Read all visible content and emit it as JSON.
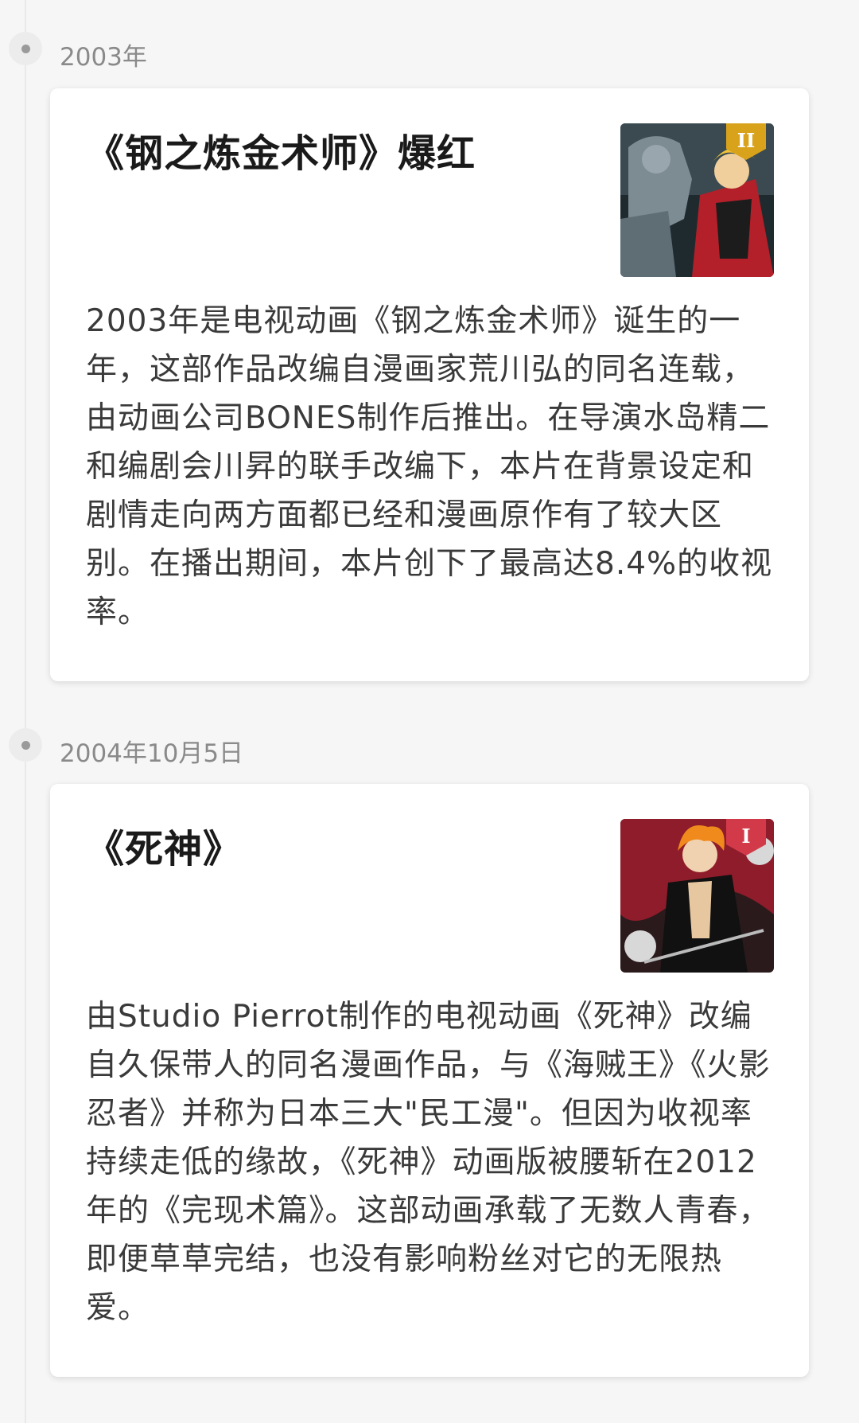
{
  "entries": [
    {
      "date": "2003年",
      "title": "《钢之炼金术师》爆红",
      "image_icon": "fullmetal-alchemist-thumbnail",
      "badge": "II",
      "body": "2003年是电视动画《钢之炼金术师》诞生的一年，这部作品改编自漫画家荒川弘的同名连载，由动画公司BONES制作后推出。在导演水岛精二和编剧会川昇的联手改编下，本片在背景设定和剧情走向两方面都已经和漫画原作有了较大区别。在播出期间，本片创下了最高达8.4%的收视率。"
    },
    {
      "date": "2004年10月5日",
      "title": "《死神》",
      "image_icon": "bleach-thumbnail",
      "badge": "I",
      "body": "由Studio Pierrot制作的电视动画《死神》改编自久保带人的同名漫画作品，与《海贼王》《火影忍者》并称为日本三大\"民工漫\"。但因为收视率持续走低的缘故，《死神》动画版被腰斩在2012年的《完现术篇》。这部动画承载了无数人青春，即便草草完结，也没有影响粉丝对它的无限热爱。"
    }
  ],
  "colors": {
    "background": "#f6f6f6",
    "card": "#ffffff",
    "date_text": "#8a8a8a",
    "title_text": "#1a1a1a",
    "body_text": "#3a3a3a",
    "badge_gold": "#d9a21b",
    "badge_red": "#d23a4a"
  }
}
